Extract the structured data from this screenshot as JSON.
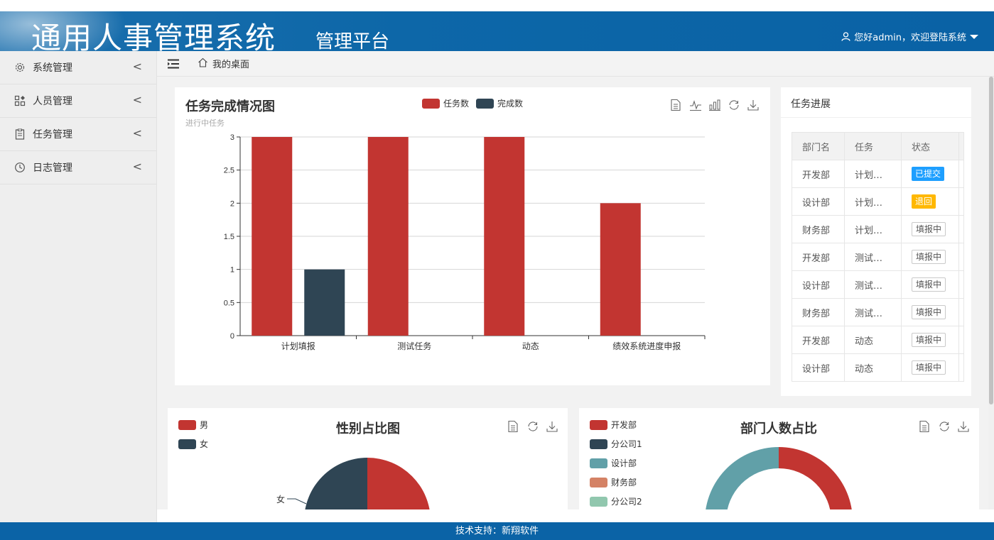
{
  "header": {
    "brand": "通用人事管理系统",
    "subtitle": "管理平台",
    "user_greeting": "您好admin，欢迎登陆系统"
  },
  "sidebar": {
    "items": [
      {
        "label": "系统管理",
        "icon": "gear-icon"
      },
      {
        "label": "人员管理",
        "icon": "apps-icon"
      },
      {
        "label": "任务管理",
        "icon": "clipboard-icon"
      },
      {
        "label": "日志管理",
        "icon": "clock-icon"
      }
    ]
  },
  "topbar": {
    "breadcrumb": "我的桌面"
  },
  "task_chart": {
    "title": "任务完成情况图",
    "subtitle": "进行中任务",
    "legend": [
      "任务数",
      "完成数"
    ]
  },
  "chart_data": [
    {
      "type": "bar",
      "title": "任务完成情况图",
      "subtitle": "进行中任务",
      "categories": [
        "计划填报",
        "测试任务",
        "动态",
        "绩效系统进度申报"
      ],
      "series": [
        {
          "name": "任务数",
          "values": [
            3,
            3,
            3,
            2
          ],
          "color": "#c23531"
        },
        {
          "name": "完成数",
          "values": [
            1,
            0,
            0,
            0
          ],
          "color": "#2f4554"
        }
      ],
      "ylim": [
        0,
        3
      ],
      "yticks": [
        "0",
        "0.5",
        "1",
        "1.5",
        "2",
        "2.5",
        "3"
      ],
      "grid": true,
      "legend_position": "top-center"
    },
    {
      "type": "pie",
      "title": "性别占比图",
      "labels": [
        "男",
        "女"
      ],
      "colors": [
        "#c23531",
        "#2f4554"
      ],
      "visible_slice_label": "女",
      "legend_position": "top-left"
    },
    {
      "type": "pie",
      "title": "部门人数占比",
      "labels": [
        "开发部",
        "分公司1",
        "设计部",
        "财务部",
        "分公司2"
      ],
      "colors": [
        "#c23531",
        "#2f4554",
        "#61a0a8",
        "#d48265",
        "#91c7ae"
      ],
      "donut": true,
      "legend_position": "top-left"
    }
  ],
  "task_progress": {
    "title": "任务进展",
    "headers": [
      "部门名",
      "任务",
      "状态"
    ],
    "rows": [
      {
        "dept": "开发部",
        "task": "计划…",
        "status": "已提交",
        "style": "blue"
      },
      {
        "dept": "设计部",
        "task": "计划…",
        "status": "退回",
        "style": "orange"
      },
      {
        "dept": "财务部",
        "task": "计划…",
        "status": "填报中",
        "style": "gray"
      },
      {
        "dept": "开发部",
        "task": "测试…",
        "status": "填报中",
        "style": "gray"
      },
      {
        "dept": "设计部",
        "task": "测试…",
        "status": "填报中",
        "style": "gray"
      },
      {
        "dept": "财务部",
        "task": "测试…",
        "status": "填报中",
        "style": "gray"
      },
      {
        "dept": "开发部",
        "task": "动态",
        "status": "填报中",
        "style": "gray"
      },
      {
        "dept": "设计部",
        "task": "动态",
        "status": "填报中",
        "style": "gray"
      }
    ]
  },
  "gender_chart": {
    "title": "性别占比图",
    "legend": [
      "男",
      "女"
    ],
    "slice_label": "女"
  },
  "dept_chart": {
    "title": "部门人数占比",
    "legend": [
      "开发部",
      "分公司1",
      "设计部",
      "财务部",
      "分公司2"
    ]
  },
  "footer": {
    "text": "技术支持：新翔软件"
  }
}
